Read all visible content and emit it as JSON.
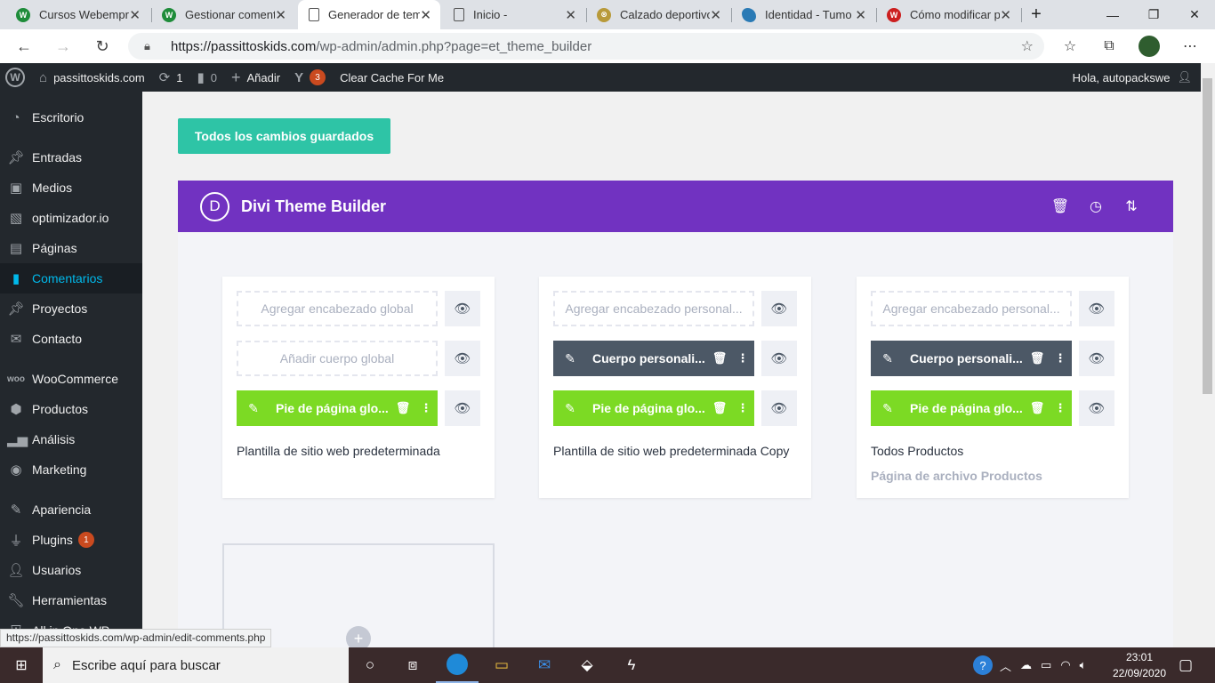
{
  "browser": {
    "tabs": [
      {
        "title": "Cursos Webempre",
        "icon": "woocommerce-icon",
        "color": "#1e8c3a"
      },
      {
        "title": "Gestionar coment",
        "icon": "woocommerce-icon",
        "color": "#1e8c3a"
      },
      {
        "title": "Generador de tem",
        "icon": "page-icon",
        "color": "#ffffff"
      },
      {
        "title": "Inicio -",
        "icon": "page-icon",
        "color": "#ffffff"
      },
      {
        "title": "Calzado deportivo",
        "icon": "globe-icon",
        "color": "#b89a3a"
      },
      {
        "title": "Identidad - Tumo",
        "icon": "bird-icon",
        "color": "#2a7ab5"
      },
      {
        "title": "Cómo modificar p",
        "icon": "wb-icon",
        "color": "#cc1f1f"
      }
    ],
    "url_host": "https://passittoskids.com",
    "url_rest": "/wp-admin/admin.php?page=et_theme_builder",
    "status_url": "https://passittoskids.com/wp-admin/edit-comments.php"
  },
  "adminbar": {
    "site": "passittoskids.com",
    "updates": "1",
    "comments": "0",
    "add": "Añadir",
    "yoast_count": "3",
    "cache": "Clear Cache For Me",
    "greeting": "Hola, autopackswe"
  },
  "sidebar": {
    "items": [
      {
        "label": "Escritorio",
        "icon": "dashboard-icon"
      },
      {
        "label": "Entradas",
        "icon": "pin-icon"
      },
      {
        "label": "Medios",
        "icon": "media-icon"
      },
      {
        "label": "optimizador.io",
        "icon": "image-icon"
      },
      {
        "label": "Páginas",
        "icon": "pages-icon"
      },
      {
        "label": "Comentarios",
        "icon": "comment-icon"
      },
      {
        "label": "Proyectos",
        "icon": "pin-icon"
      },
      {
        "label": "Contacto",
        "icon": "mail-icon"
      },
      {
        "label": "WooCommerce",
        "icon": "woo-icon"
      },
      {
        "label": "Productos",
        "icon": "box-icon"
      },
      {
        "label": "Análisis",
        "icon": "chart-icon"
      },
      {
        "label": "Marketing",
        "icon": "megaphone-icon"
      },
      {
        "label": "Apariencia",
        "icon": "brush-icon"
      },
      {
        "label": "Plugins",
        "icon": "plug-icon",
        "badge": "1"
      },
      {
        "label": "Usuarios",
        "icon": "user-icon"
      },
      {
        "label": "Herramientas",
        "icon": "wrench-icon"
      },
      {
        "label": "All in One WP",
        "icon": "shield-icon"
      }
    ]
  },
  "main": {
    "saved_button": "Todos los cambios guardados",
    "builder_logo": "D",
    "builder_title": "Divi Theme Builder",
    "cards": [
      {
        "header": {
          "kind": "empty",
          "label": "Agregar encabezado global"
        },
        "body": {
          "kind": "empty",
          "label": "Añadir cuerpo global"
        },
        "footer": {
          "kind": "green",
          "label": "Pie de página glo..."
        },
        "name": "Plantilla de sitio web predeterminada",
        "sub": ""
      },
      {
        "header": {
          "kind": "empty",
          "label": "Agregar encabezado personal..."
        },
        "body": {
          "kind": "dark",
          "label": "Cuerpo personali..."
        },
        "footer": {
          "kind": "green",
          "label": "Pie de página glo..."
        },
        "name": "Plantilla de sitio web predeterminada Copy",
        "sub": ""
      },
      {
        "header": {
          "kind": "empty",
          "label": "Agregar encabezado personal..."
        },
        "body": {
          "kind": "dark",
          "label": "Cuerpo personali..."
        },
        "footer": {
          "kind": "green",
          "label": "Pie de página glo..."
        },
        "name": "Todos Productos",
        "sub": "Página de archivo Productos"
      }
    ]
  },
  "taskbar": {
    "search_placeholder": "Escribe aquí para buscar",
    "time": "23:01",
    "date": "22/09/2020"
  },
  "colors": {
    "divi_purple": "#7132c1",
    "saved_green": "#2ec4a6",
    "footer_green": "#7cda24",
    "dark_slot": "#4c5866"
  }
}
